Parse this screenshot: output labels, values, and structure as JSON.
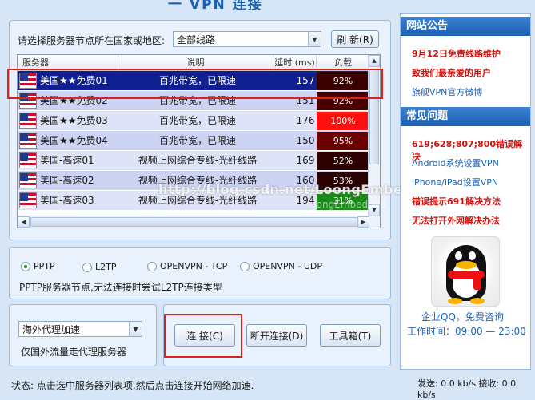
{
  "window": {
    "title": "一 VPN 连接"
  },
  "country": {
    "label": "请选择服务器节点所在国家或地区:",
    "selected": "全部线路",
    "refresh_label": "刷 新(R)"
  },
  "table": {
    "headers": [
      "服务器",
      "说明",
      "延时 (ms)",
      "负载"
    ],
    "rows": [
      {
        "name": "美国★★免费01",
        "desc": "百兆带宽，已限速",
        "latency": "157",
        "load": "92%",
        "load_color": "#3a0000",
        "selected": true
      },
      {
        "name": "美国★★免费02",
        "desc": "百兆带宽，已限速",
        "latency": "151",
        "load": "92%",
        "load_color": "#4a0000",
        "selected": false
      },
      {
        "name": "美国★★免费03",
        "desc": "百兆带宽，已限速",
        "latency": "176",
        "load": "100%",
        "load_color": "#ff1010",
        "selected": false
      },
      {
        "name": "美国★★免费04",
        "desc": "百兆带宽，已限速",
        "latency": "150",
        "load": "95%",
        "load_color": "#6a0000",
        "selected": false
      },
      {
        "name": "美国-高速01",
        "desc": "视频上网综合专线-光纤线路",
        "latency": "169",
        "load": "52%",
        "load_color": "#2a0000",
        "selected": false
      },
      {
        "name": "美国-高速02",
        "desc": "视频上网综合专线-光纤线路",
        "latency": "160",
        "load": "53%",
        "load_color": "#2a0000",
        "selected": false
      },
      {
        "name": "美国-高速03",
        "desc": "视频上网综合专线-光纤线路",
        "latency": "194",
        "load": "31%",
        "load_color": "#1a8a1a",
        "selected": false
      }
    ]
  },
  "watermark": {
    "text": "http://blog.csdn.net/LoongEmbedded",
    "faint": "loongEmbedded"
  },
  "protocols": {
    "options": [
      "PPTP",
      "L2TP",
      "OPENVPN - TCP",
      "OPENVPN - UDP"
    ],
    "selected": "PPTP",
    "hint": "PPTP服务器节点,无法连接时尝试L2TP连接类型"
  },
  "mode": {
    "selected": "海外代理加速",
    "hint": "仅国外流量走代理服务器"
  },
  "buttons": {
    "connect": "连 接(C)",
    "disconnect": "断开连接(D)",
    "toolbox": "工具箱(T)"
  },
  "status": {
    "text": "状态:  点击选中服务器列表项,然后点击连接开始网络加速.",
    "traffic": "发送: 0.0 kb/s 接收: 0.0 kb/s"
  },
  "sidebar": {
    "announcement_title": "网站公告",
    "announcements": [
      {
        "text": "9月12日免费线路维护",
        "style": "red"
      },
      {
        "text": "致我们最亲爱的用户",
        "style": "red"
      },
      {
        "text": "旗舰VPN官方微博",
        "style": "blue"
      }
    ],
    "faq_title": "常见问题",
    "faqs": [
      {
        "text": "619;628;807;800错误解决",
        "style": "red"
      },
      {
        "text": "Android系统设置VPN",
        "style": "blue"
      },
      {
        "text": "iPhone/iPad设置VPN",
        "style": "blue"
      },
      {
        "text": "错误提示691解决方法",
        "style": "red"
      },
      {
        "text": "无法打开外网解决办法",
        "style": "red"
      }
    ],
    "qq_title": "企业QQ，免费咨询",
    "qq_time": "工作时间：09:00 — 23:00"
  },
  "colors": {
    "accent": "#1c5fb3",
    "selected_row": "#0f1f8f",
    "highlight": "#e0201a"
  }
}
